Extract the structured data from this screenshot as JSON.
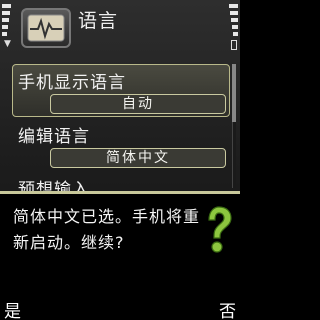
{
  "header": {
    "title": "语言",
    "app_icon": "oscilloscope-wave-icon"
  },
  "list": {
    "items": [
      {
        "label": "手机显示语言",
        "value": "自动"
      },
      {
        "label": "编辑语言",
        "value": "简体中文"
      },
      {
        "label": "预想输入"
      }
    ]
  },
  "dialog": {
    "message": "简体中文已选。手机将重新启动。继续?",
    "icon": "question-mark-icon"
  },
  "softkeys": {
    "left": "是",
    "right": "否"
  },
  "colors": {
    "highlight_border": "#b9b98a",
    "question_mark": "#8dc63f"
  }
}
